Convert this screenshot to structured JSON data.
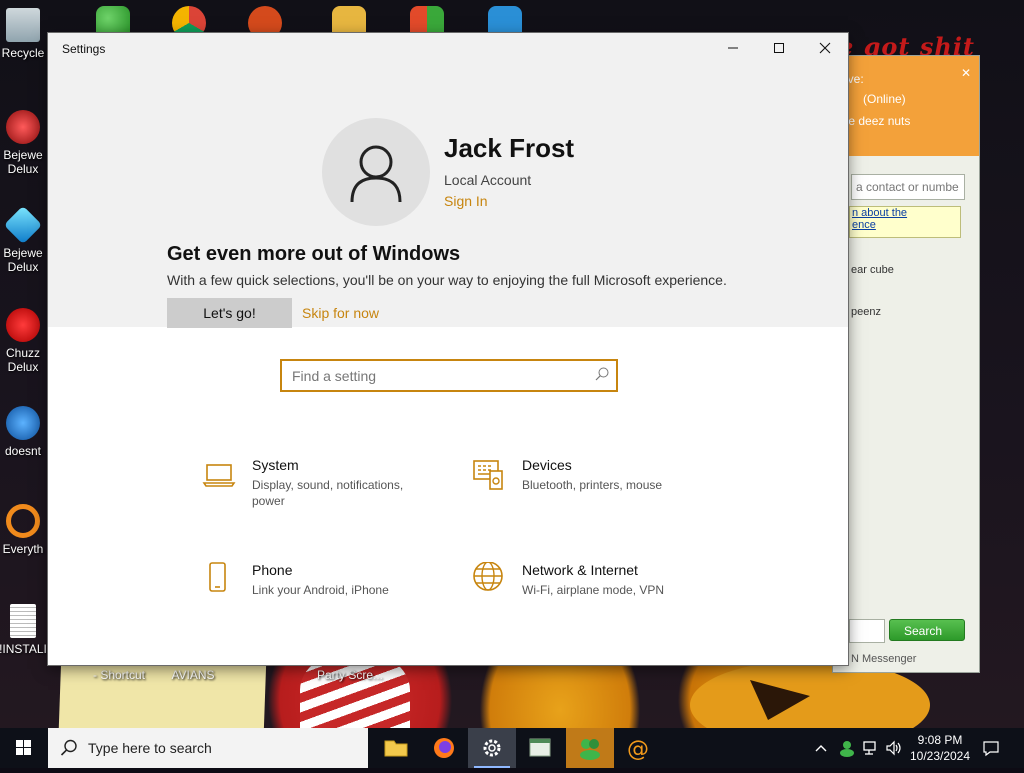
{
  "settings": {
    "window_title": "Settings",
    "user": {
      "name": "Jack Frost",
      "account_type": "Local Account",
      "sign_in": "Sign In"
    },
    "promo": {
      "title": "Get even more out of Windows",
      "description": "With a few quick selections, you'll be on your way to enjoying the full Microsoft experience.",
      "go_label": "Let's go!",
      "skip_label": "Skip for now"
    },
    "search": {
      "placeholder": "Find a setting"
    },
    "categories": [
      {
        "title": "System",
        "desc": "Display, sound, notifications, power",
        "icon": "laptop-icon"
      },
      {
        "title": "Devices",
        "desc": "Bluetooth, printers, mouse",
        "icon": "devices-icon"
      },
      {
        "title": "Phone",
        "desc": "Link your Android, iPhone",
        "icon": "phone-icon"
      },
      {
        "title": "Network & Internet",
        "desc": "Wi-Fi, airplane mode, VPN",
        "icon": "globe-icon"
      }
    ],
    "accent_color": "#c7850f"
  },
  "desktop": {
    "icons": [
      "Recycle",
      "Bejewe Delux",
      "Bejewe Delux",
      "Chuzz Delux",
      "doesnt",
      "Everyth",
      "!INSTALI"
    ],
    "bottom_labels": [
      "- Shortcut",
      "AVIANS",
      "Party Scre..."
    ],
    "wallpaper_text": "e got shit"
  },
  "messenger": {
    "status_line1": "ive:",
    "status_line2": "(Online)",
    "status_line3": "te deez nuts",
    "search_placeholder": "a contact or numbe",
    "link_line1": "n about the",
    "link_line2": "ence",
    "contact1": "ear cube",
    "contact2": "peenz",
    "search_button": "Search",
    "footer": "N Messenger"
  },
  "taskbar": {
    "search_text": "Type here to search",
    "time": "9:08 PM",
    "date": "10/23/2024"
  }
}
